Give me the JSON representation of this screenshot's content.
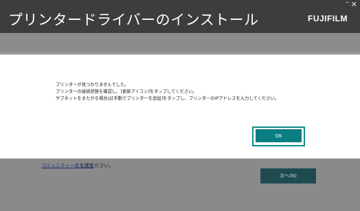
{
  "window": {
    "title": "プリンタードライバーのインストール",
    "brand": "FUJIFILM",
    "minimize_glyph": "–",
    "close_glyph": "✕"
  },
  "background": {
    "community_link": "コミュニティー名を設定",
    "community_suffix": "してください。",
    "next_button": "次へ(N)"
  },
  "dialog": {
    "lines": [
      "プリンターが見つかりませんでした。",
      "プリンターの接続状態を確認し、[更新アイコン]をタップしてください。",
      "サブネットをまたがる場合は[手動でプリンターを追加]をタップし、プリンターのIPアドレスを入力してください。"
    ],
    "ok_button": "OK"
  },
  "colors": {
    "titlebar": "#3d3d3d",
    "accent": "#0b7e83",
    "overlay": "#8a8a8a"
  }
}
